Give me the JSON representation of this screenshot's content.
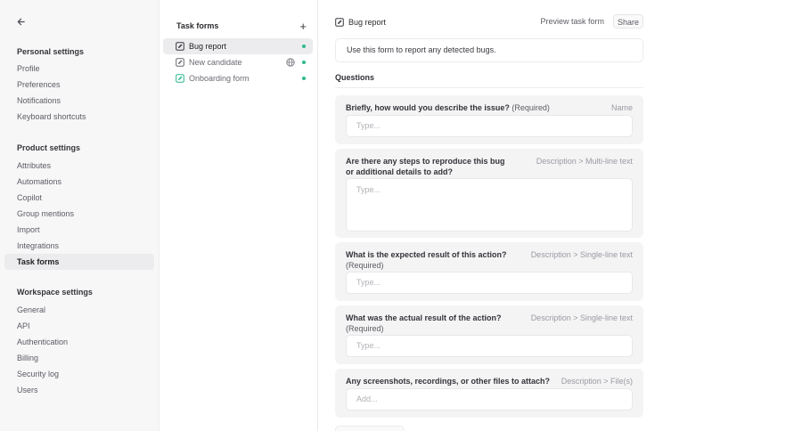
{
  "sidebar": {
    "personal": {
      "title": "Personal settings",
      "items": [
        "Profile",
        "Preferences",
        "Notifications",
        "Keyboard shortcuts"
      ]
    },
    "product": {
      "title": "Product settings",
      "items": [
        "Attributes",
        "Automations",
        "Copilot",
        "Group mentions",
        "Import",
        "Integrations",
        "Task forms"
      ]
    },
    "workspace": {
      "title": "Workspace settings",
      "items": [
        "General",
        "API",
        "Authentication",
        "Billing",
        "Security log",
        "Users"
      ]
    }
  },
  "forms": {
    "title": "Task forms",
    "items": [
      {
        "name": "Bug report"
      },
      {
        "name": "New candidate"
      },
      {
        "name": "Onboarding form"
      }
    ],
    "status_color": "#2db88f"
  },
  "main": {
    "title": "Bug report",
    "preview_label": "Preview task form",
    "share_label": "Share",
    "intro": "Use this form to report any detected bugs.",
    "questions_label": "Questions",
    "questions": [
      {
        "text": "Briefly, how would you describe the issue?",
        "required": "(Required)",
        "type": "Name",
        "placeholder": "Type..."
      },
      {
        "text": "Are there any steps to reproduce this bug or additional details to add?",
        "required": "",
        "type": "Description > Multi-line text",
        "placeholder": "Type..."
      },
      {
        "text": "What is the expected result of this action?",
        "required": "(Required)",
        "type": "Description > Single-line text",
        "placeholder": "Type..."
      },
      {
        "text": "What was the actual result of the action?",
        "required": "(Required)",
        "type": "Description > Single-line text",
        "placeholder": "Type..."
      },
      {
        "text": "Any screenshots, recordings, or other files to attach?",
        "required": "",
        "type": "Description > File(s)",
        "placeholder": "Add..."
      }
    ]
  }
}
